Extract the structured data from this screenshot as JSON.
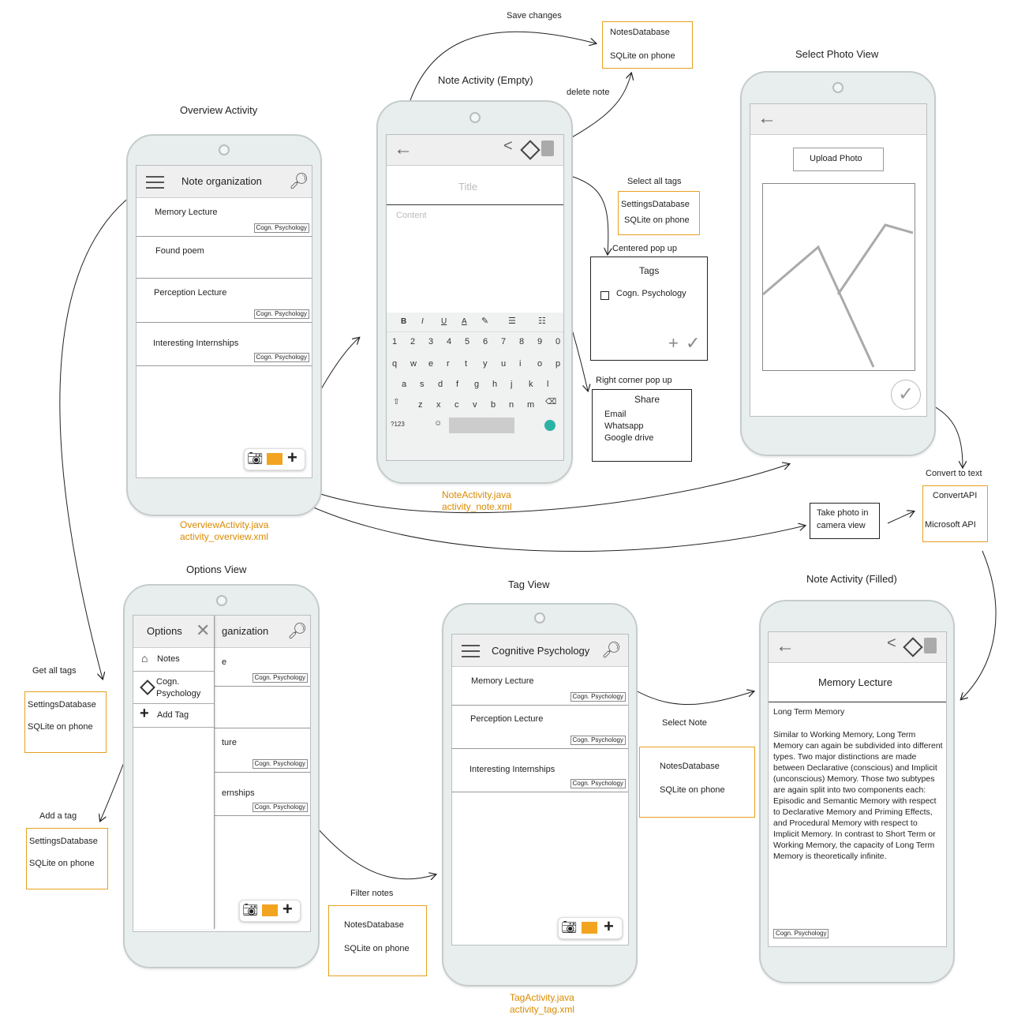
{
  "labels": {
    "save_changes": "Save changes",
    "note_activity_empty": "Note Activity (Empty)",
    "delete_note": "delete note",
    "select_photo_view": "Select Photo View",
    "overview_activity": "Overview Activity",
    "select_all_tags": "Select all tags",
    "centered_popup": "Centered pop up",
    "right_corner_popup": "Right corner pop up",
    "convert_to_text": "Convert to text",
    "options_view": "Options View",
    "tag_view": "Tag View",
    "note_activity_filled": "Note Activity (Filled)",
    "get_all_tags": "Get all tags",
    "add_a_tag": "Add a tag",
    "filter_notes": "Filter notes",
    "select_note": "Select Note"
  },
  "files": {
    "overview": [
      "OverviewActivity.java",
      "activity_overview.xml"
    ],
    "note": [
      "NoteActivity.java",
      "activity_note.xml"
    ],
    "tag": [
      "TagActivity.java",
      "activity_tag.xml"
    ]
  },
  "databases": {
    "notes_top": [
      "NotesDatabase",
      "SQLite on phone"
    ],
    "settings_tags": [
      "SettingsDatabase",
      "SQLite on phone"
    ],
    "settings_get": [
      "SettingsDatabase",
      "SQLite on phone"
    ],
    "settings_add": [
      "SettingsDatabase",
      "SQLite on phone"
    ],
    "notes_filter": [
      "NotesDatabase",
      "SQLite on phone"
    ],
    "notes_select": [
      "NotesDatabase",
      "SQLite on phone"
    ],
    "convert_api": [
      "ConvertAPI",
      "Microsoft API"
    ]
  },
  "take_photo": [
    "Take photo in",
    "camera view"
  ],
  "overview": {
    "title": "Note organization",
    "notes": [
      {
        "title": "Memory Lecture",
        "tag": "Cogn. Psychology"
      },
      {
        "title": "Found poem",
        "tag": ""
      },
      {
        "title": "Perception Lecture",
        "tag": "Cogn. Psychology"
      },
      {
        "title": "Interesting Internships",
        "tag": "Cogn. Psychology"
      }
    ]
  },
  "note_empty": {
    "title_placeholder": "Title",
    "content_placeholder": "Content",
    "keyboard": {
      "digits": [
        "1",
        "2",
        "3",
        "4",
        "5",
        "6",
        "7",
        "8",
        "9",
        "0"
      ],
      "row1": [
        "q",
        "w",
        "e",
        "r",
        "t",
        "y",
        "u",
        "i",
        "o",
        "p"
      ],
      "row2": [
        "a",
        "s",
        "d",
        "f",
        "g",
        "h",
        "j",
        "k",
        "l"
      ],
      "row3": [
        "z",
        "x",
        "c",
        "v",
        "b",
        "n",
        "m"
      ],
      "symbols": "?123"
    },
    "format_bar": [
      "B",
      "I",
      "U",
      "A"
    ]
  },
  "tags_popup": {
    "title": "Tags",
    "item": "Cogn. Psychology"
  },
  "share_popup": {
    "title": "Share",
    "items": [
      "Email",
      "Whatsapp",
      "Google drive"
    ]
  },
  "photo_view": {
    "upload": "Upload Photo"
  },
  "options": {
    "title": "Options",
    "items": [
      "Notes",
      "Cogn. Psychology",
      "Add Tag"
    ],
    "behind_title": "ganization",
    "behind_rows": [
      "e",
      "",
      "ture",
      "ernships"
    ],
    "behind_tag": "Cogn. Psychology"
  },
  "tag_view": {
    "title": "Cognitive Psychology",
    "notes": [
      {
        "title": "Memory Lecture",
        "tag": "Cogn. Psychology"
      },
      {
        "title": "Perception Lecture",
        "tag": "Cogn. Psychology"
      },
      {
        "title": "Interesting Internships",
        "tag": "Cogn. Psychology"
      }
    ]
  },
  "note_filled": {
    "title": "Memory Lecture",
    "heading": "Long Term Memory",
    "body": "Similar to Working Memory, Long Term Memory can again be subdivided into different types. Two major distinctions are made between Declarative (conscious) and Implicit (unconscious) Memory. Those two subtypes are again split into two components each: Episodic and Semantic Memory with respect to Declarative Memory and Priming Effects, and Procedural Memory with respect to Implicit Memory. In contrast to Short Term or Working Memory, the capacity of Long Term Memory is theoretically infinite.",
    "tag": "Cogn. Psychology"
  },
  "colors": {
    "file_label": "#d98a00",
    "db_border": "#e8a020",
    "phone_body": "#e8eded"
  }
}
